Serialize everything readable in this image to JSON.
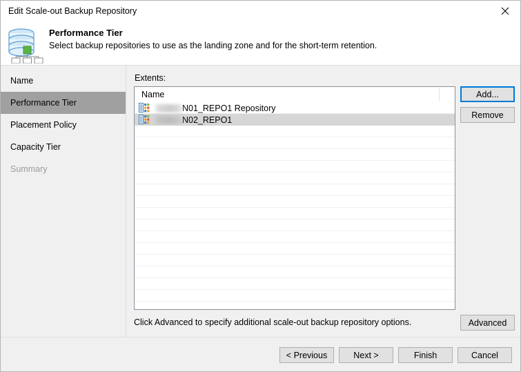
{
  "window": {
    "title": "Edit Scale-out Backup Repository",
    "close_icon": "close-icon"
  },
  "header": {
    "icon": "scale-out-repository-icon",
    "title": "Performance Tier",
    "subtitle": "Select backup repositories to use as the landing zone and for the short-term retention."
  },
  "sidebar": {
    "items": [
      {
        "label": "Name",
        "state": "normal"
      },
      {
        "label": "Performance Tier",
        "state": "selected"
      },
      {
        "label": "Placement Policy",
        "state": "normal"
      },
      {
        "label": "Capacity Tier",
        "state": "normal"
      },
      {
        "label": "Summary",
        "state": "disabled"
      }
    ]
  },
  "main": {
    "extents_label": "Extents:",
    "columns": [
      "Name"
    ],
    "rows": [
      {
        "icon": "repository-extent-icon",
        "redacted": true,
        "name": "N01_REPO1 Repository",
        "selected": false
      },
      {
        "icon": "repository-extent-icon",
        "redacted": true,
        "name": "N02_REPO1",
        "selected": true
      }
    ],
    "buttons": {
      "add": "Add...",
      "remove": "Remove",
      "advanced": "Advanced"
    },
    "hint": "Click Advanced to specify additional scale-out backup repository options."
  },
  "footer": {
    "previous": "< Previous",
    "next": "Next >",
    "finish": "Finish",
    "cancel": "Cancel"
  },
  "colors": {
    "accent": "#0078d7",
    "selection": "#d6d6d6",
    "nav_selection": "#a0a0a0",
    "panel": "#f0f0f0"
  }
}
